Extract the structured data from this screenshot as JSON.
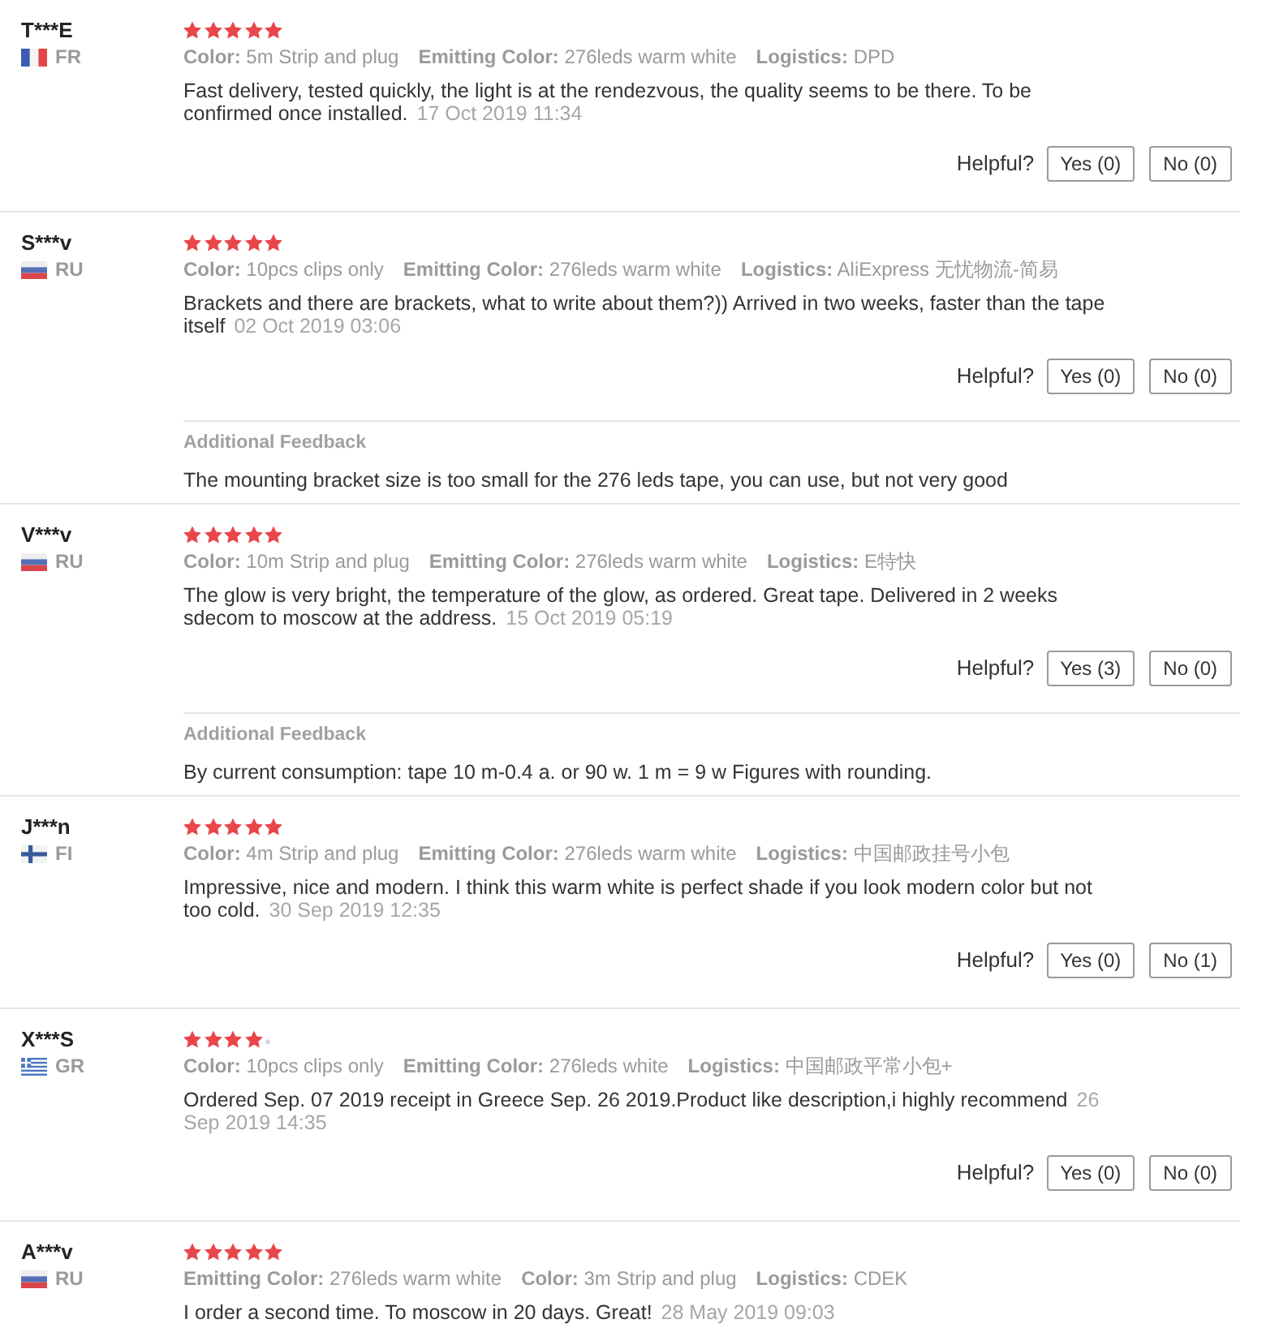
{
  "reviews": [
    {
      "user": "T***E",
      "flag": {
        "kind": "fr"
      },
      "country": "FR",
      "stars": 5,
      "attributes": [
        {
          "label": "Color:",
          "value": "5m Strip and plug"
        },
        {
          "label": "Emitting Color:",
          "value": "276leds warm white"
        },
        {
          "label": "Logistics:",
          "value": "DPD"
        }
      ],
      "text": "Fast delivery, tested quickly, the light is at the rendezvous, the quality seems to be there. To be confirmed once installed.",
      "date": "17 Oct 2019 11:34",
      "helpful": {
        "label": "Helpful?",
        "yes": "Yes (0)",
        "no": "No (0)"
      }
    },
    {
      "user": "S***v",
      "flag": {
        "kind": "ru"
      },
      "country": "RU",
      "stars": 5,
      "attributes": [
        {
          "label": "Color:",
          "value": "10pcs clips only"
        },
        {
          "label": "Emitting Color:",
          "value": "276leds warm white"
        },
        {
          "label": "Logistics:",
          "value": "AliExpress 无忧物流-简易"
        }
      ],
      "text": "Brackets and there are brackets, what to write about them?)) Arrived in two weeks, faster than the tape itself",
      "date": "02 Oct 2019 03:06",
      "helpful": {
        "label": "Helpful?",
        "yes": "Yes (0)",
        "no": "No (0)"
      },
      "additional_feedback": {
        "title": "Additional Feedback",
        "text": "The mounting bracket size is too small for the 276 leds tape, you can use, but not very good"
      }
    },
    {
      "user": "V***v",
      "flag": {
        "kind": "ru"
      },
      "country": "RU",
      "stars": 5,
      "attributes": [
        {
          "label": "Color:",
          "value": "10m Strip and plug"
        },
        {
          "label": "Emitting Color:",
          "value": "276leds warm white"
        },
        {
          "label": "Logistics:",
          "value": "E特快"
        }
      ],
      "text": "The glow is very bright, the temperature of the glow, as ordered. Great tape. Delivered in 2 weeks sdecom to moscow at the address.",
      "date": "15 Oct 2019 05:19",
      "helpful": {
        "label": "Helpful?",
        "yes": "Yes (3)",
        "no": "No (0)"
      },
      "additional_feedback": {
        "title": "Additional Feedback",
        "text": "By current consumption: tape 10 m-0.4 a. or 90 w. 1 m = 9 w Figures with rounding."
      }
    },
    {
      "user": "J***n",
      "flag": {
        "kind": "fi"
      },
      "country": "FI",
      "stars": 5,
      "attributes": [
        {
          "label": "Color:",
          "value": "4m Strip and plug"
        },
        {
          "label": "Emitting Color:",
          "value": "276leds warm white"
        },
        {
          "label": "Logistics:",
          "value": "中国邮政挂号小包"
        }
      ],
      "text": "Impressive, nice and modern. I think this warm white is perfect shade if you look modern color but not too cold.",
      "date": "30 Sep 2019 12:35",
      "helpful": {
        "label": "Helpful?",
        "yes": "Yes (0)",
        "no": "No (1)"
      }
    },
    {
      "user": "X***S",
      "flag": {
        "kind": "gr"
      },
      "country": "GR",
      "stars": 4,
      "attributes": [
        {
          "label": "Color:",
          "value": "10pcs clips only"
        },
        {
          "label": "Emitting Color:",
          "value": "276leds white"
        },
        {
          "label": "Logistics:",
          "value": "中国邮政平常小包+"
        }
      ],
      "text": "Ordered Sep. 07 2019 receipt in Greece Sep. 26 2019.Product like description,i highly recommend",
      "date": "26 Sep 2019 14:35",
      "helpful": {
        "label": "Helpful?",
        "yes": "Yes (0)",
        "no": "No (0)"
      }
    },
    {
      "user": "A***v",
      "flag": {
        "kind": "ru"
      },
      "country": "RU",
      "stars": 5,
      "attributes": [
        {
          "label": "Emitting Color:",
          "value": "276leds warm white"
        },
        {
          "label": "Color:",
          "value": "3m Strip and plug"
        },
        {
          "label": "Logistics:",
          "value": "CDEK"
        }
      ],
      "text": "I order a second time. To moscow in 20 days. Great!",
      "date": "28 May 2019 09:03"
    }
  ]
}
